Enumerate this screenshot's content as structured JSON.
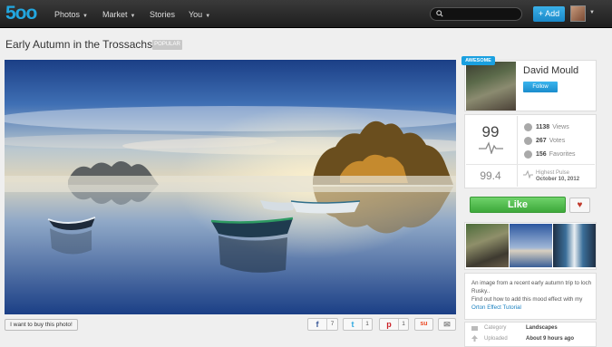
{
  "nav": {
    "logo": "5oo",
    "items": [
      {
        "label": "Photos",
        "has_caret": true
      },
      {
        "label": "Market",
        "has_caret": true
      },
      {
        "label": "Stories",
        "has_caret": false
      },
      {
        "label": "You",
        "has_caret": true
      }
    ],
    "add_label": "+ Add",
    "caret": "▼"
  },
  "photo": {
    "title": "Early Autumn in the Trossachs...",
    "badge": "POPULAR"
  },
  "actions": {
    "buy_label": "I want to buy this photo!",
    "share": [
      {
        "icon": "f",
        "count": "7",
        "color": "#3b5998"
      },
      {
        "icon": "t",
        "count": "1",
        "color": "#2fa9e0"
      },
      {
        "icon": "p",
        "count": "1",
        "color": "#cb2027"
      },
      {
        "icon": "su",
        "count": "",
        "color": "#eb4924"
      },
      {
        "icon": "✉",
        "count": "",
        "color": "#888888"
      }
    ]
  },
  "author": {
    "badge": "AWESOME",
    "name": "David Mould",
    "follow_label": "Follow"
  },
  "stats": {
    "pulse": "99",
    "highest": "99.4",
    "views_value": "1138",
    "views_label": "Views",
    "votes_value": "267",
    "votes_label": "Votes",
    "favorites_value": "156",
    "favorites_label": "Favorites",
    "highest_label": "Highest Pulse",
    "highest_date": "October 10, 2012"
  },
  "like_label": "Like",
  "heart": "♥",
  "description": {
    "line1": "An image from a recent early autumn trip to loch Rusky..",
    "line2": "Find out how to add this mood effect with my ",
    "link": "Orton Effect Tutorial"
  },
  "meta": {
    "category_label": "Category",
    "category_value": "Landscapes",
    "uploaded_label": "Uploaded",
    "uploaded_value": "About 9 hours ago"
  },
  "colors": {
    "accent": "#1aa0e0",
    "like_green": "#4cbb48"
  }
}
